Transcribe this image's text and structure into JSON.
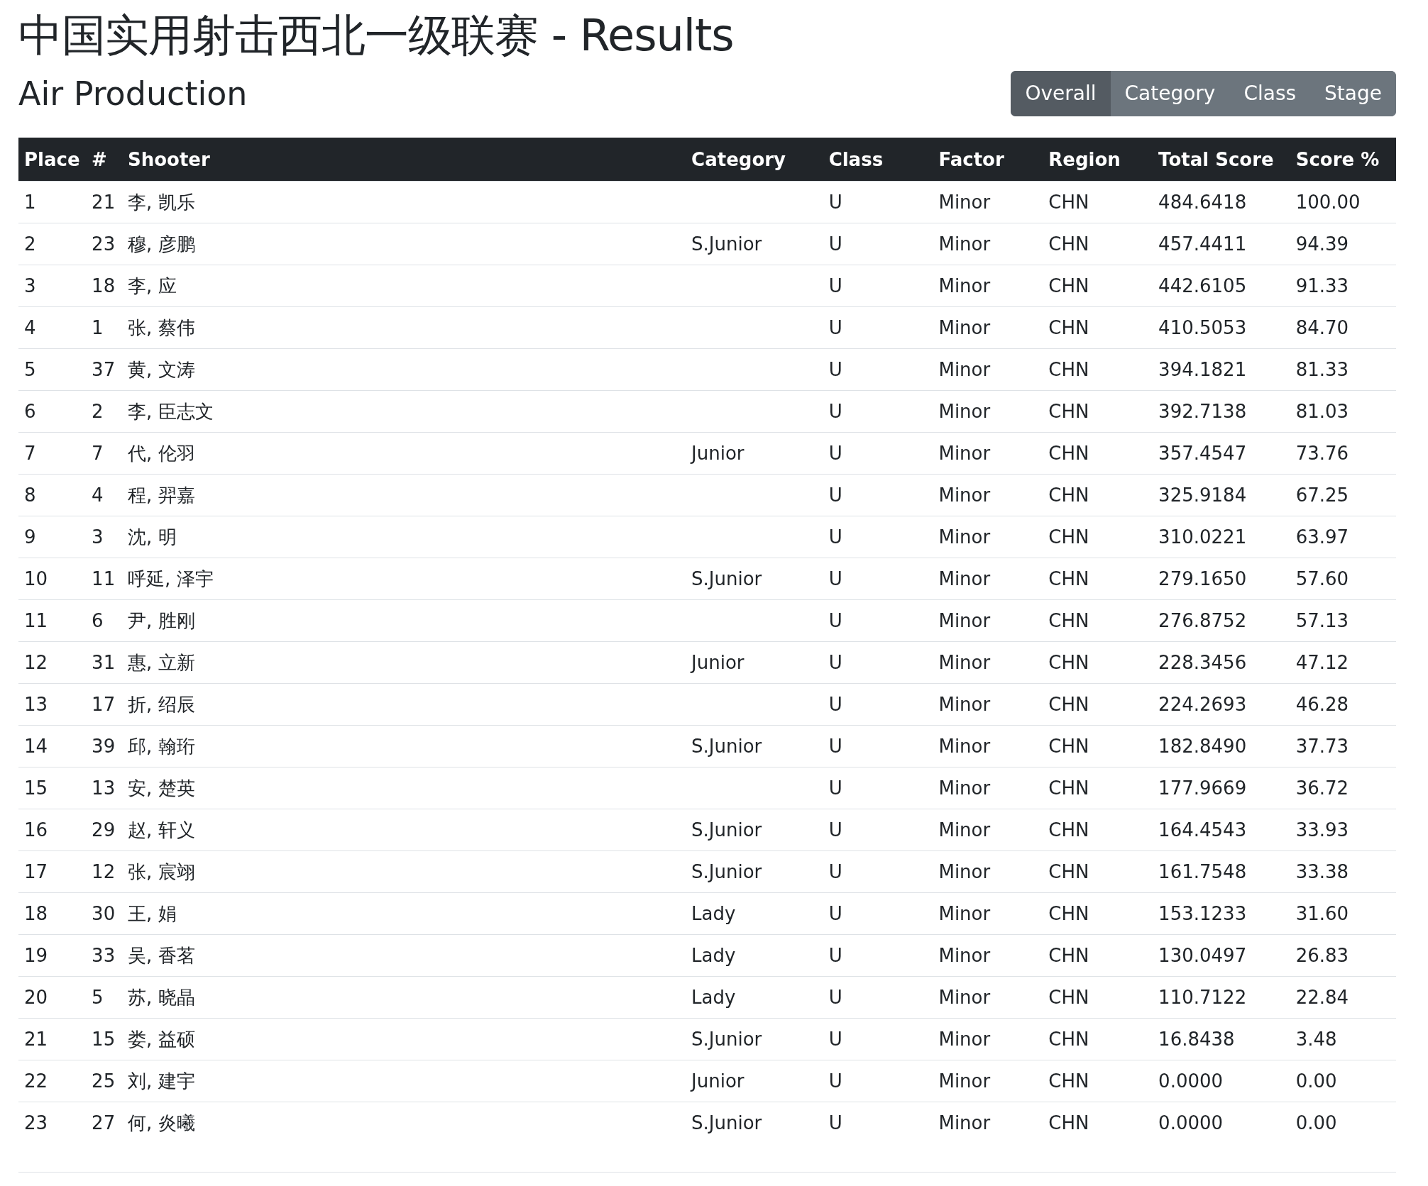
{
  "title": "中国实用射击西北一级联赛 - Results",
  "subtitle": "Air Production",
  "view_tabs": [
    {
      "label": "Overall",
      "selected": true
    },
    {
      "label": "Category",
      "selected": false
    },
    {
      "label": "Class",
      "selected": false
    },
    {
      "label": "Stage",
      "selected": false
    }
  ],
  "table": {
    "columns": [
      "Place",
      "#",
      "Shooter",
      "Category",
      "Class",
      "Factor",
      "Region",
      "Total Score",
      "Score %"
    ],
    "rows": [
      {
        "place": "1",
        "number": "21",
        "shooter": "李, 凯乐",
        "class": "U",
        "factor": "Minor",
        "region": "CHN",
        "total_score": "484.6418",
        "score_pct": "100.00"
      },
      {
        "place": "2",
        "number": "23",
        "shooter": "穆, 彦鹏",
        "category": "S.Junior",
        "class": "U",
        "factor": "Minor",
        "region": "CHN",
        "total_score": "457.4411",
        "score_pct": "94.39"
      },
      {
        "place": "3",
        "number": "18",
        "shooter": "李, 应",
        "class": "U",
        "factor": "Minor",
        "region": "CHN",
        "total_score": "442.6105",
        "score_pct": "91.33"
      },
      {
        "place": "4",
        "number": "1",
        "shooter": "张, 蔡伟",
        "class": "U",
        "factor": "Minor",
        "region": "CHN",
        "total_score": "410.5053",
        "score_pct": "84.70"
      },
      {
        "place": "5",
        "number": "37",
        "shooter": "黄, 文涛",
        "class": "U",
        "factor": "Minor",
        "region": "CHN",
        "total_score": "394.1821",
        "score_pct": "81.33"
      },
      {
        "place": "6",
        "number": "2",
        "shooter": "李, 臣志文",
        "class": "U",
        "factor": "Minor",
        "region": "CHN",
        "total_score": "392.7138",
        "score_pct": "81.03"
      },
      {
        "place": "7",
        "number": "7",
        "shooter": "代, 伦羽",
        "category": "Junior",
        "class": "U",
        "factor": "Minor",
        "region": "CHN",
        "total_score": "357.4547",
        "score_pct": "73.76"
      },
      {
        "place": "8",
        "number": "4",
        "shooter": "程, 羿嘉",
        "class": "U",
        "factor": "Minor",
        "region": "CHN",
        "total_score": "325.9184",
        "score_pct": "67.25"
      },
      {
        "place": "9",
        "number": "3",
        "shooter": "沈, 明",
        "class": "U",
        "factor": "Minor",
        "region": "CHN",
        "total_score": "310.0221",
        "score_pct": "63.97"
      },
      {
        "place": "10",
        "number": "11",
        "shooter": "呼延, 泽宇",
        "category": "S.Junior",
        "class": "U",
        "factor": "Minor",
        "region": "CHN",
        "total_score": "279.1650",
        "score_pct": "57.60"
      },
      {
        "place": "11",
        "number": "6",
        "shooter": "尹, 胜刚",
        "class": "U",
        "factor": "Minor",
        "region": "CHN",
        "total_score": "276.8752",
        "score_pct": "57.13"
      },
      {
        "place": "12",
        "number": "31",
        "shooter": "惠, 立新",
        "category": "Junior",
        "class": "U",
        "factor": "Minor",
        "region": "CHN",
        "total_score": "228.3456",
        "score_pct": "47.12"
      },
      {
        "place": "13",
        "number": "17",
        "shooter": "折, 绍辰",
        "class": "U",
        "factor": "Minor",
        "region": "CHN",
        "total_score": "224.2693",
        "score_pct": "46.28"
      },
      {
        "place": "14",
        "number": "39",
        "shooter": "邱, 翰珩",
        "category": "S.Junior",
        "class": "U",
        "factor": "Minor",
        "region": "CHN",
        "total_score": "182.8490",
        "score_pct": "37.73"
      },
      {
        "place": "15",
        "number": "13",
        "shooter": "安, 楚英",
        "class": "U",
        "factor": "Minor",
        "region": "CHN",
        "total_score": "177.9669",
        "score_pct": "36.72"
      },
      {
        "place": "16",
        "number": "29",
        "shooter": "赵, 轩义",
        "category": "S.Junior",
        "class": "U",
        "factor": "Minor",
        "region": "CHN",
        "total_score": "164.4543",
        "score_pct": "33.93"
      },
      {
        "place": "17",
        "number": "12",
        "shooter": "张, 宸翊",
        "category": "S.Junior",
        "class": "U",
        "factor": "Minor",
        "region": "CHN",
        "total_score": "161.7548",
        "score_pct": "33.38"
      },
      {
        "place": "18",
        "number": "30",
        "shooter": "王, 娟",
        "category": "Lady",
        "class": "U",
        "factor": "Minor",
        "region": "CHN",
        "total_score": "153.1233",
        "score_pct": "31.60"
      },
      {
        "place": "19",
        "number": "33",
        "shooter": "吴, 香茗",
        "category": "Lady",
        "class": "U",
        "factor": "Minor",
        "region": "CHN",
        "total_score": "130.0497",
        "score_pct": "26.83"
      },
      {
        "place": "20",
        "number": "5",
        "shooter": "苏, 晓晶",
        "category": "Lady",
        "class": "U",
        "factor": "Minor",
        "region": "CHN",
        "total_score": "110.7122",
        "score_pct": "22.84"
      },
      {
        "place": "21",
        "number": "15",
        "shooter": "娄, 益硕",
        "category": "S.Junior",
        "class": "U",
        "factor": "Minor",
        "region": "CHN",
        "total_score": "16.8438",
        "score_pct": "3.48"
      },
      {
        "place": "22",
        "number": "25",
        "shooter": "刘, 建宇",
        "category": "Junior",
        "class": "U",
        "factor": "Minor",
        "region": "CHN",
        "total_score": "0.0000",
        "score_pct": "0.00"
      },
      {
        "place": "23",
        "number": "27",
        "shooter": "何, 炎曦",
        "category": "S.Junior",
        "class": "U",
        "factor": "Minor",
        "region": "CHN",
        "total_score": "0.0000",
        "score_pct": "0.00"
      }
    ]
  }
}
